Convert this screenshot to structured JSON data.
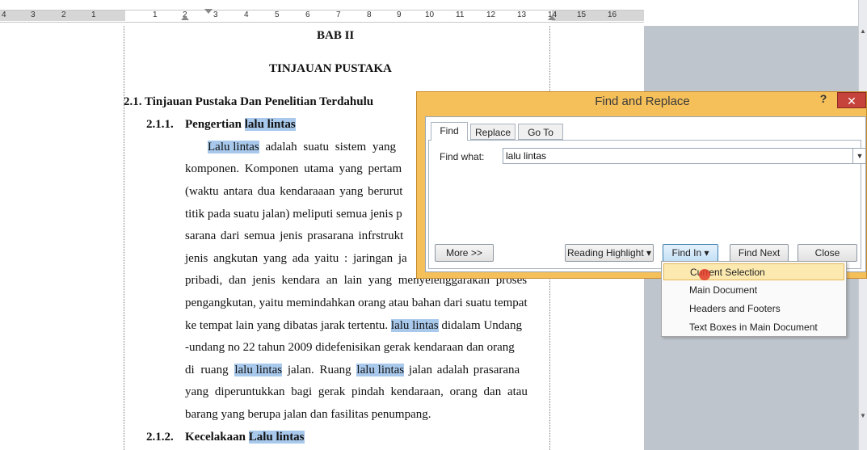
{
  "ruler": {
    "numbers_left": [
      "4",
      "3",
      "2",
      "1"
    ],
    "numbers_right": [
      "1",
      "2",
      "3",
      "4",
      "5",
      "6",
      "7",
      "8",
      "9",
      "10",
      "11",
      "12",
      "13",
      "14",
      "15",
      "16"
    ]
  },
  "document": {
    "chapter": "BAB II",
    "chapter_title": "TINJAUAN PUSTAKA",
    "section": "2.1. Tinjauan Pustaka Dan Penelitian Terdahulu",
    "sub1_num": "2.1.1.",
    "sub1_title_a": "Pengertian ",
    "sub1_title_hl": "lalu lintas",
    "lines": {
      "l1_hl": "Lalu lintas",
      "l1_rest": " adalah suatu sistem yang",
      "l2": "komponen. Komponen utama yang pertam",
      "l3": "(waktu antara dua kendaraaan yang berurut",
      "l4": "titik pada suatu jalan) meliputi semua jenis p",
      "l5": "sarana dari semua jenis prasarana infrstrukt",
      "l6": "jenis angkutan yang ada yaitu : jaringan ja",
      "l7": "pribadi, dan jenis kendara an lain yang menyelenggarakan proses",
      "l8": "pengangkutan, yaitu memindahkan orang atau bahan dari suatu tempat",
      "l9_a": "ke tempat lain yang dibatas jarak tertentu. ",
      "l9_hl": "lalu lintas",
      "l9_b": " didalam Undang",
      "l10": "-undang  no 22 tahun 2009 didefenisikan gerak kendaraan dan orang",
      "l11_a": "di ruang ",
      "l11_hl1": "lalu lintas",
      "l11_b": " jalan. Ruang ",
      "l11_hl2": "lalu lintas",
      "l11_c": " jalan adalah prasarana",
      "l12": "yang diperuntukkan bagi gerak pindah kendaraan, orang dan atau",
      "l13": "barang  yang berupa jalan dan fasilitas penumpang."
    },
    "sub2_num": "2.1.2.",
    "sub2_title_a": "Kecelakaan ",
    "sub2_title_hl": "Lalu lintas"
  },
  "dialog": {
    "title": "Find and Replace",
    "help": "?",
    "close": "✕",
    "tabs": [
      "Find",
      "Replace",
      "Go To"
    ],
    "find_what_label": "Find what:",
    "find_what_value": "lalu lintas",
    "buttons": {
      "more": "More >>",
      "reading_highlight": "Reading Highlight ▾",
      "find_in": "Find In ▾",
      "find_next": "Find Next",
      "close": "Close"
    }
  },
  "find_in_menu": {
    "items": [
      "Current Selection",
      "Main Document",
      "Headers and Footers",
      "Text Boxes in Main Document"
    ],
    "selected": "Current Selection"
  },
  "colors": {
    "dialog_frame": "#f5bf5a",
    "highlight": "#a9c9ec",
    "close_button": "#c6433b",
    "menu_selected": "#fce9b0"
  }
}
